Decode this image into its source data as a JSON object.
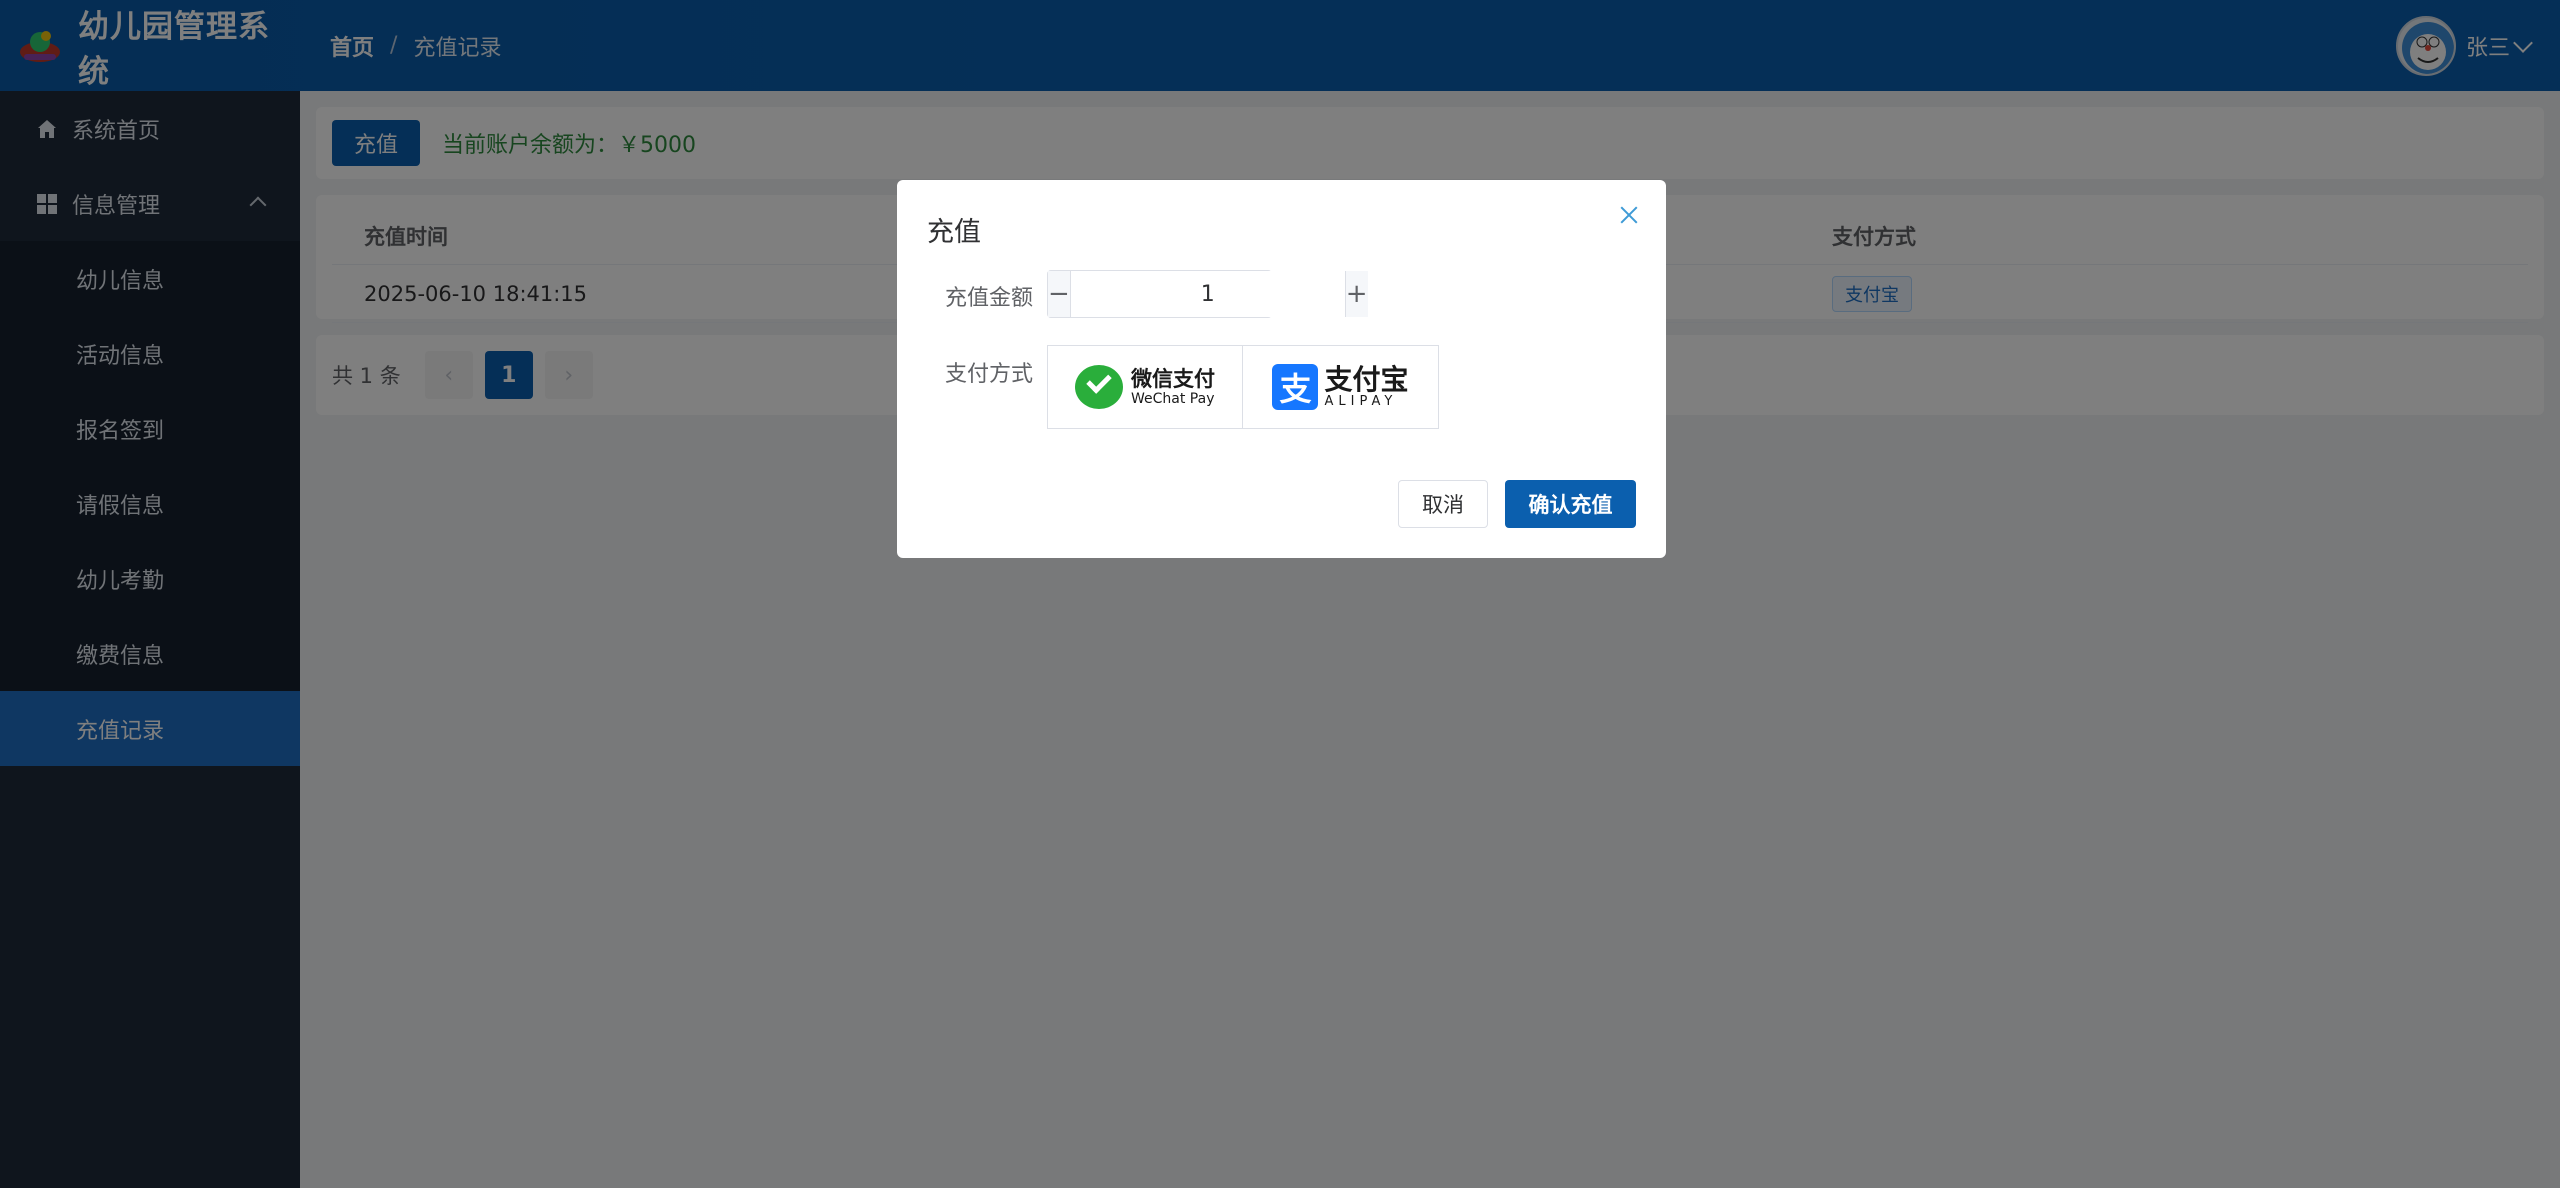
{
  "app": {
    "title": "幼儿园管理系统"
  },
  "breadcrumb": {
    "home": "首页",
    "separator": "/",
    "current": "充值记录"
  },
  "user": {
    "name": "张三"
  },
  "sidebar": {
    "items": [
      {
        "label": "系统首页",
        "icon": "home-icon"
      },
      {
        "label": "信息管理",
        "icon": "grid-icon"
      }
    ],
    "subitems": [
      {
        "label": "幼儿信息"
      },
      {
        "label": "活动信息"
      },
      {
        "label": "报名签到"
      },
      {
        "label": "请假信息"
      },
      {
        "label": "幼儿考勤"
      },
      {
        "label": "缴费信息"
      },
      {
        "label": "充值记录"
      }
    ]
  },
  "toolbar": {
    "recharge_label": "充值",
    "balance_text": "当前账户余额为：￥5000"
  },
  "table": {
    "headers": {
      "time": "充值时间",
      "pay": "支付方式"
    },
    "rows": [
      {
        "time": "2025-06-10 18:41:15",
        "pay": "支付宝"
      }
    ]
  },
  "pager": {
    "total": "共 1 条",
    "prev": "‹",
    "current": "1",
    "next": "›"
  },
  "dialog": {
    "title": "充值",
    "amount_label": "充值金额",
    "amount_value": "1",
    "minus": "−",
    "plus": "+",
    "pay_label": "支付方式",
    "wechat_cn": "微信支付",
    "wechat_en": "WeChat Pay",
    "alipay_mark": "支",
    "alipay_cn": "支付宝",
    "alipay_en": "ALIPAY",
    "cancel_label": "取消",
    "confirm_label": "确认充值"
  },
  "colors": {
    "primary": "#0b5fae",
    "sidebar": "#1f2b3a",
    "active": "#1e6fc4",
    "balance": "#2e8b3e"
  }
}
